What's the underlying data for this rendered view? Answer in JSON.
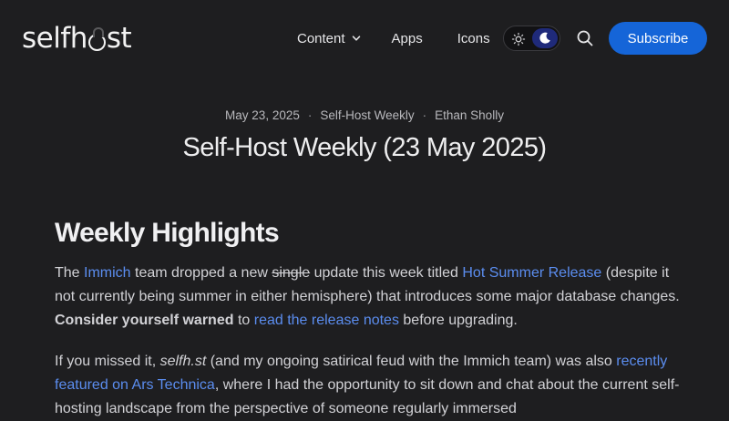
{
  "header": {
    "logo_prefix": "selfh",
    "logo_suffix": "st",
    "nav": [
      {
        "label": "Content"
      },
      {
        "label": "Apps"
      },
      {
        "label": "Icons"
      }
    ],
    "subscribe_label": "Subscribe",
    "icons": [
      "chevron-down-icon",
      "sun-icon",
      "moon-icon",
      "search-icon"
    ]
  },
  "post": {
    "date": "May 23, 2025",
    "category": "Self-Host Weekly",
    "author": "Ethan Sholly",
    "separator": "·",
    "title": "Self-Host Weekly (23 May 2025)"
  },
  "article": {
    "section_heading": "Weekly Highlights",
    "p1": {
      "t1": "The ",
      "link_immich": "Immich",
      "t2": " team dropped a new ",
      "strike": "single",
      "t3": " update this week titled ",
      "link_release": "Hot Summer Release",
      "t4": " (despite it not currently being summer in either hemisphere) that introduces some major database changes. ",
      "bold": "Consider yourself warned",
      "t5": " to ",
      "link_notes": "read the release notes",
      "t6": " before upgrading."
    },
    "p2": {
      "t1": "If you missed it, ",
      "em": "selfh.st",
      "t2": " (and my ongoing satirical feud with the Immich team) was also ",
      "link_ars": "recently featured on Ars Technica",
      "t3": ", where I had the opportunity to sit down and chat about the current self-hosting landscape from the perspective of someone regularly immersed"
    }
  },
  "colors": {
    "background": "#1e1e20",
    "accent": "#1565d8",
    "link": "#5b8def"
  }
}
